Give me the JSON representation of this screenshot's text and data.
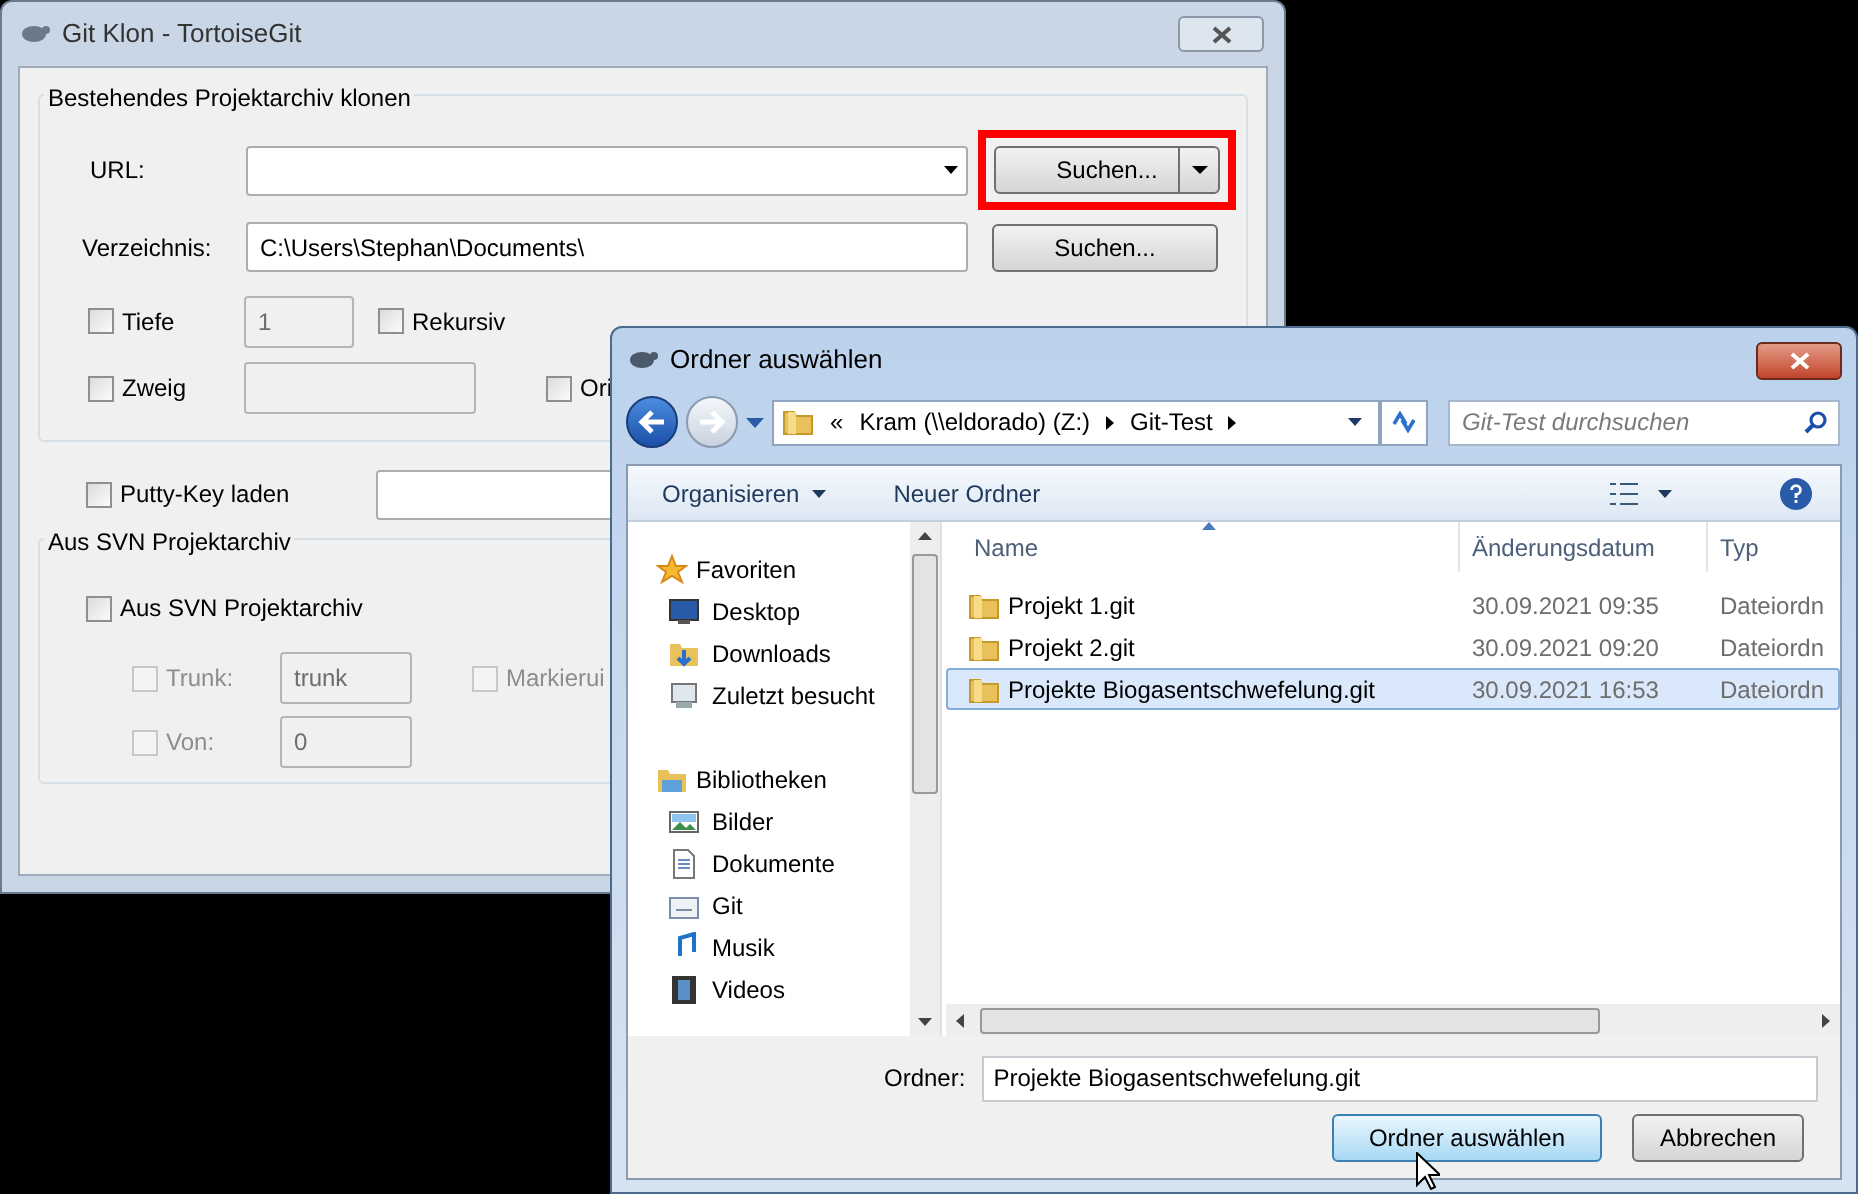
{
  "clone_window": {
    "title": "Git Klon - TortoiseGit",
    "clone_group": {
      "label": "Bestehendes Projektarchiv klonen",
      "url": {
        "label": "URL:",
        "browse_button": {
          "label": "Suchen...",
          "highlighted": true
        }
      },
      "directory": {
        "label": "Verzeichnis:",
        "value": "C:\\Users\\Stephan\\Documents\\",
        "browse_button": {
          "label": "Suchen..."
        }
      },
      "depth": {
        "label": "Tiefe",
        "checked": false,
        "value": "1",
        "recursive": {
          "label": "Rekursiv",
          "checked": false
        }
      },
      "branch": {
        "label": "Zweig",
        "checked": false,
        "origin": {
          "label": "Ori",
          "checked": false
        }
      }
    },
    "putty_key": {
      "label": "Putty-Key laden",
      "checked": false
    },
    "svn_group": {
      "label": "Aus SVN Projektarchiv",
      "from_svn": {
        "label": "Aus SVN Projektarchiv",
        "checked": false
      },
      "trunk": {
        "label": "Trunk:",
        "checked": false,
        "disabled": true,
        "value": "trunk"
      },
      "tags": {
        "label": "Markierui",
        "checked": false,
        "disabled": true
      },
      "from": {
        "label": "Von:",
        "checked": false,
        "disabled": true,
        "value": "0"
      }
    }
  },
  "folder_dialog": {
    "title": "Ordner auswählen",
    "breadcrumb": [
      "«",
      "Kram (\\\\eldorado) (Z:)",
      "Git-Test"
    ],
    "search": {
      "placeholder": "Git-Test durchsuchen"
    },
    "toolbar": [
      "Organisieren",
      "Neuer Ordner"
    ],
    "nav": [
      {
        "label": "Favoriten",
        "kind": "star",
        "children": [
          {
            "label": "Desktop",
            "kind": "desktop"
          },
          {
            "label": "Downloads",
            "kind": "downloads"
          },
          {
            "label": "Zuletzt besucht",
            "kind": "recent"
          }
        ]
      },
      {
        "label": "Bibliotheken",
        "kind": "libraries",
        "children": [
          {
            "label": "Bilder",
            "kind": "pictures"
          },
          {
            "label": "Dokumente",
            "kind": "documents"
          },
          {
            "label": "Git",
            "kind": "git"
          },
          {
            "label": "Musik",
            "kind": "music"
          },
          {
            "label": "Videos",
            "kind": "videos"
          }
        ]
      }
    ],
    "columns": [
      "Name",
      "Änderungsdatum",
      "Typ"
    ],
    "rows": [
      {
        "name": "Projekt 1.git",
        "date": "30.09.2021 09:35",
        "type": "Dateiordn",
        "selected": false
      },
      {
        "name": "Projekt 2.git",
        "date": "30.09.2021 09:20",
        "type": "Dateiordn",
        "selected": false
      },
      {
        "name": "Projekte Biogasentschwefelung.git",
        "date": "30.09.2021 16:53",
        "type": "Dateiordn",
        "selected": true
      }
    ],
    "folder_field": {
      "label": "Ordner:",
      "value": "Projekte Biogasentschwefelung.git"
    },
    "buttons": [
      {
        "label": "Ordner auswählen",
        "default": true
      },
      {
        "label": "Abbrechen",
        "default": false
      }
    ]
  }
}
